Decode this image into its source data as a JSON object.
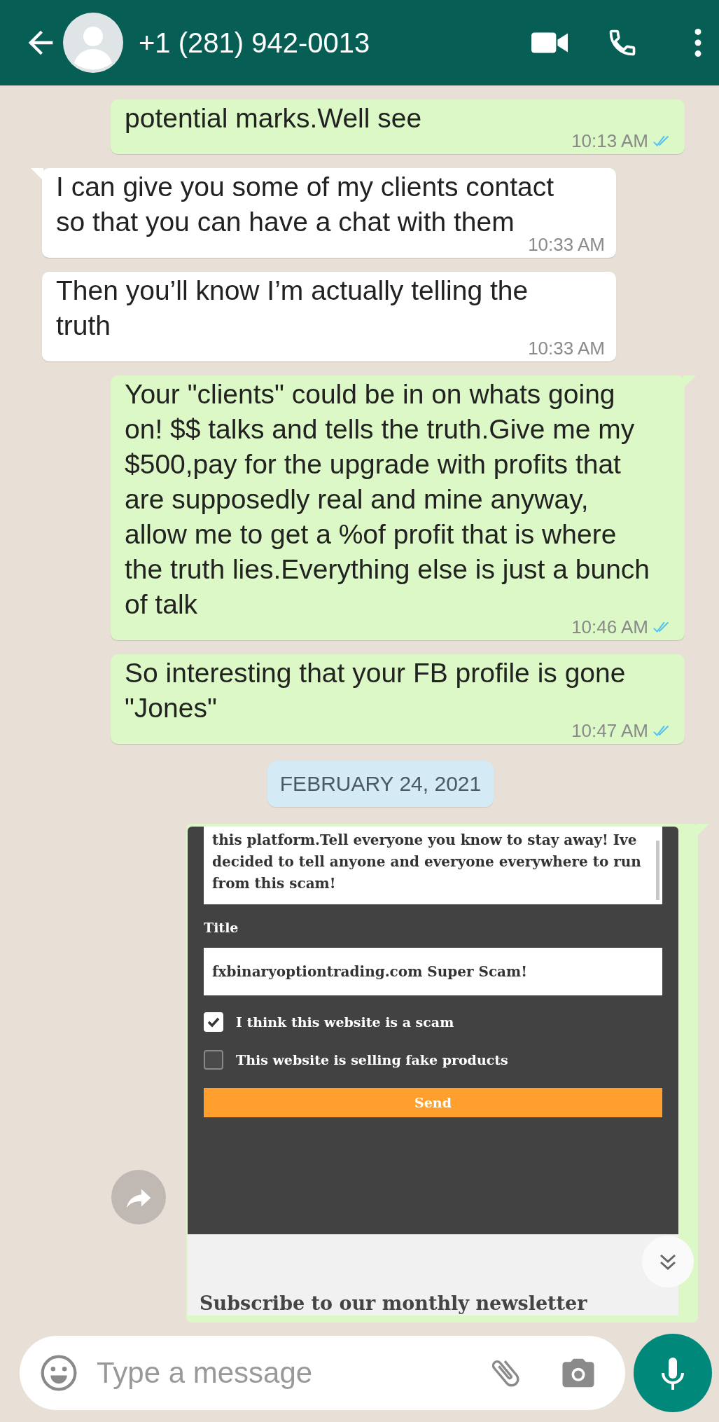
{
  "header": {
    "contact": "+1 (281) 942-0013"
  },
  "messages": [
    {
      "kind": "text",
      "outgoing": true,
      "tail": false,
      "text": "potential marks.Well see",
      "time": "10:13 AM",
      "read": true
    },
    {
      "kind": "text",
      "outgoing": false,
      "tail": true,
      "text": "I can give you some of my clients contact so that you can have a chat with them",
      "time": "10:33 AM"
    },
    {
      "kind": "text",
      "outgoing": false,
      "tail": false,
      "text": "Then you’ll know I’m actually telling the truth",
      "time": "10:33 AM"
    },
    {
      "kind": "text",
      "outgoing": true,
      "tail": true,
      "text": "Your \"clients\" could be in on whats going on! $$ talks and tells the truth.Give me my $500,pay for the upgrade with profits that are supposedly real and mine anyway, allow me to get a %of profit that is where the truth lies.Everything else is just a bunch of talk",
      "time": "10:46 AM",
      "read": true
    },
    {
      "kind": "text",
      "outgoing": true,
      "tail": false,
      "text": "So interesting that your FB profile is gone \"Jones\"",
      "time": "10:47 AM",
      "read": true
    },
    {
      "kind": "date",
      "text": "FEBRUARY 24, 2021"
    },
    {
      "kind": "image",
      "outgoing": true,
      "tail": true,
      "form": {
        "review": "this platform.Tell everyone you know to stay away! Ive decided to tell anyone and everyone everywhere to run from this scam!",
        "title_label": "Title",
        "title_value": "fxbinaryoptiontrading.com Super Scam!",
        "checkboxes": [
          {
            "label": "I think this website is a scam",
            "checked": true
          },
          {
            "label": "This website is selling fake products",
            "checked": false
          }
        ],
        "send": "Send",
        "newsletter": "Subscribe to our monthly newsletter"
      }
    }
  ],
  "composer": {
    "placeholder": "Type a message"
  }
}
